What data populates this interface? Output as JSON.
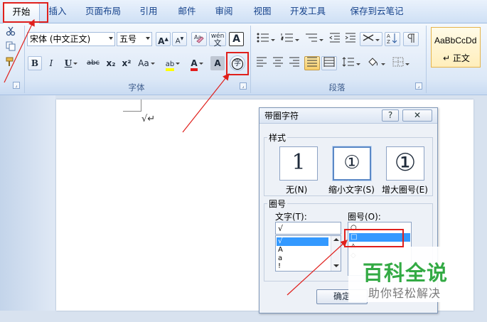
{
  "tabs": [
    "开始",
    "插入",
    "页面布局",
    "引用",
    "邮件",
    "审阅",
    "视图",
    "开发工具",
    "保存到云笔记"
  ],
  "font": {
    "name": "宋体 (中文正文)",
    "size": "五号",
    "group_label": "字体",
    "btn_bold": "B",
    "btn_italic": "I",
    "btn_underline": "U",
    "btn_strike": "abc",
    "btn_sub": "x₂",
    "btn_sup": "x²",
    "btn_case": "Aa",
    "btn_grow": "A",
    "btn_shrink": "A",
    "btn_phonetic": "wén",
    "btn_phonetic_char": "文",
    "btn_charborder": "A",
    "btn_charshade": "A",
    "btn_enclose": "字",
    "btn_highlight": "ab",
    "btn_fontcolor": "A"
  },
  "paragraph": {
    "group_label": "段落"
  },
  "styles": {
    "sample": "AaBbCcDd",
    "name": "↵ 正文"
  },
  "document": {
    "text": "√↵"
  },
  "dialog": {
    "title": "带圈字符",
    "help": "?",
    "close": "✕",
    "style_legend": "样式",
    "options": [
      {
        "label": "无(N)",
        "glyph": "1"
      },
      {
        "label": "缩小文字(S)",
        "glyph": "①"
      },
      {
        "label": "增大圈号(E)",
        "glyph": "①"
      }
    ],
    "circle_legend": "圈号",
    "text_label": "文字(T):",
    "text_value": "√",
    "text_items": [
      "√",
      "A",
      "a",
      "!"
    ],
    "enclosure_label": "圈号(O):",
    "enclosure_items": [
      "○",
      "□",
      "△",
      "◇"
    ],
    "ok": "确定"
  },
  "watermark": {
    "title": "百科全说",
    "subtitle": "助你轻松解决"
  },
  "colors": {
    "accent": "#15428b",
    "red_annotation": "#e0201c",
    "watermark_green": "#33aa44"
  }
}
